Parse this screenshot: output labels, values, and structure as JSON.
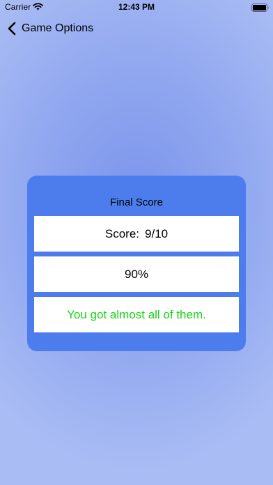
{
  "status_bar": {
    "carrier": "Carrier",
    "time": "12:43 PM",
    "wifi_icon": "wifi-icon",
    "battery_icon": "battery-icon"
  },
  "nav": {
    "back_icon": "chevron-left-icon",
    "back_label": "Game Options"
  },
  "card": {
    "title": "Final Score",
    "score_label": "Score:",
    "score_value": "9/10",
    "percent": "90%",
    "message": "You got almost all of them."
  },
  "colors": {
    "card_background": "#4d7ded",
    "message_text": "#17d417",
    "page_background": "#8ea5ef"
  }
}
